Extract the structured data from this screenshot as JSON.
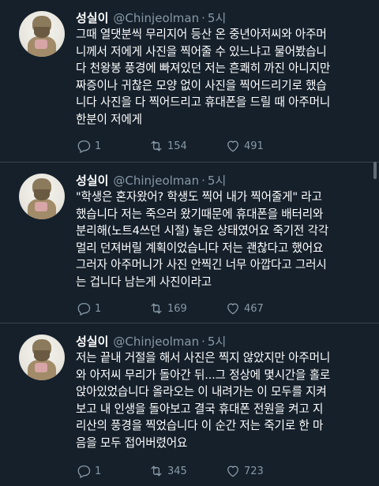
{
  "tweets": [
    {
      "name": "성실이",
      "handle": "@Chinjeolman",
      "separator": "·",
      "time": "5시",
      "lines": [
        "그때 열댓분씩 무리지어 등산 온 중년아저씨와 아주머",
        "니께서 저에게 사진을 찍어줄 수 있느냐고 물어봤습니",
        "다 천왕봉 풍경에 빠져있던 저는 흔쾌히 까진 아니지만",
        "짜증이나 귀찮은 모양 없이 사진을 찍어드리기로 했습",
        "니다 사진을 다 찍어드리고 휴대폰을 드릴 때 아주머니",
        "한분이 저에게"
      ],
      "replies": "1",
      "retweets": "154",
      "likes": "491"
    },
    {
      "name": "성실이",
      "handle": "@Chinjeolman",
      "separator": "·",
      "time": "5시",
      "lines": [
        "\"학생은 혼자왔어? 학생도 찍어 내가 찍어줄게\" 라고",
        "했습니다 저는 죽으러 왔기때문에 휴대폰을 배터리와",
        "분리해(노트4쓰던 시절) 놓은 상태였어요 죽기전 각각",
        "멀리 던져버릴 계획이었습니다 저는 괜찮다고 했어요",
        "그러자 아주머니가 사진 안찍긴 너무 아깝다고 그러시",
        "는 겁니다 남는게 사진이라고"
      ],
      "replies": "1",
      "retweets": "169",
      "likes": "467"
    },
    {
      "name": "성실이",
      "handle": "@Chinjeolman",
      "separator": "·",
      "time": "5시",
      "lines": [
        "저는 끝내 거절을 해서 사진은 찍지 않았지만 아주머니",
        "와 아저씨 무리가 돌아간 뒤...그 정상에 몇시간을 홀로",
        "앉아있었습니다 올라오는 이 내려가는 이 모두를 지켜",
        "보고 내 인생을 돌아보고 결국 휴대폰 전원을 켜고 지",
        "리산의 풍경을 찍었습니다 이 순간 저는 죽기로 한 마",
        "음을 모두 접어버렸어요"
      ],
      "replies": "1",
      "retweets": "345",
      "likes": "723"
    }
  ],
  "icons": {
    "reply": "reply-icon",
    "retweet": "retweet-icon",
    "like": "heart-icon"
  },
  "colors": {
    "background": "#15202b",
    "secondary_text": "#8899a6",
    "divider": "#38444d"
  }
}
